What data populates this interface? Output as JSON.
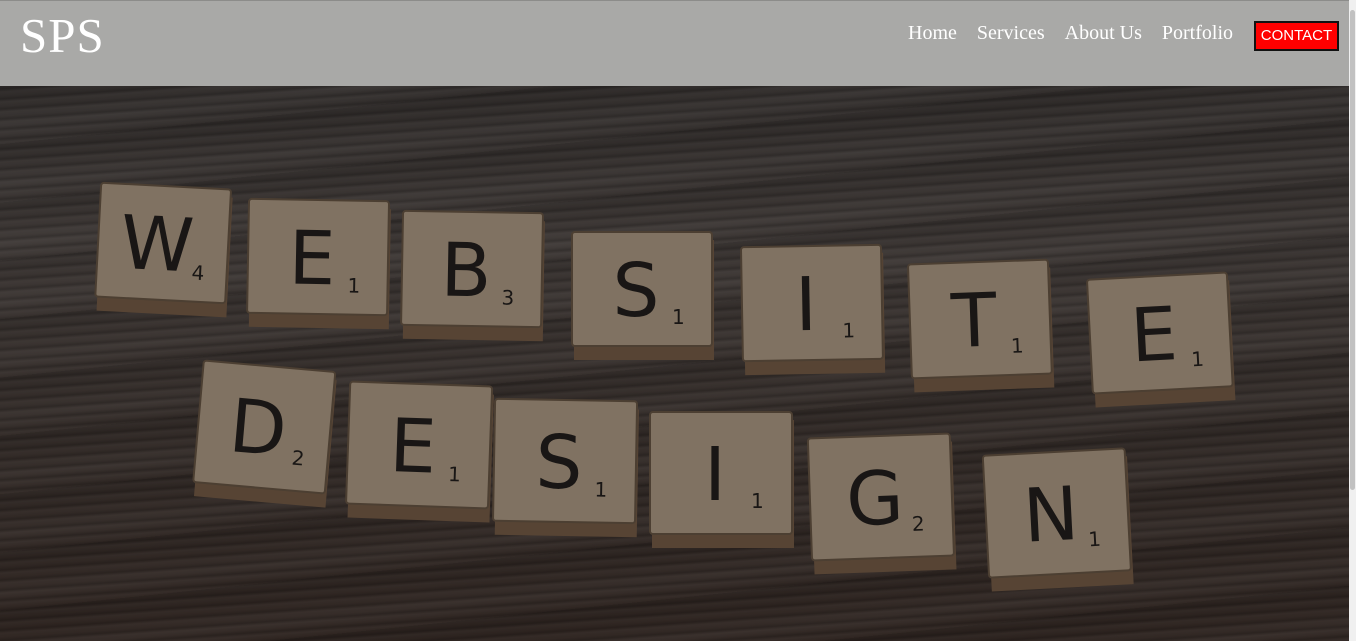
{
  "header": {
    "logo": "SPS",
    "nav": [
      {
        "label": "Home"
      },
      {
        "label": "Services"
      },
      {
        "label": "About Us"
      },
      {
        "label": "Portfolio"
      }
    ],
    "contact_label": "CONTACT"
  },
  "colors": {
    "header_bg": "#a9a9a7",
    "contact_bg": "#ff0000",
    "tile": "#9d8c78"
  },
  "hero": {
    "rows": [
      {
        "word": "WEBSITE",
        "tiles": [
          {
            "letter": "W",
            "score": "4"
          },
          {
            "letter": "E",
            "score": "1"
          },
          {
            "letter": "B",
            "score": "3"
          },
          {
            "letter": "S",
            "score": "1"
          },
          {
            "letter": "I",
            "score": "1"
          },
          {
            "letter": "T",
            "score": "1"
          },
          {
            "letter": "E",
            "score": "1"
          }
        ]
      },
      {
        "word": "DESIGN",
        "tiles": [
          {
            "letter": "D",
            "score": "2"
          },
          {
            "letter": "E",
            "score": "1"
          },
          {
            "letter": "S",
            "score": "1"
          },
          {
            "letter": "I",
            "score": "1"
          },
          {
            "letter": "G",
            "score": "2"
          },
          {
            "letter": "N",
            "score": "1"
          }
        ]
      }
    ]
  }
}
